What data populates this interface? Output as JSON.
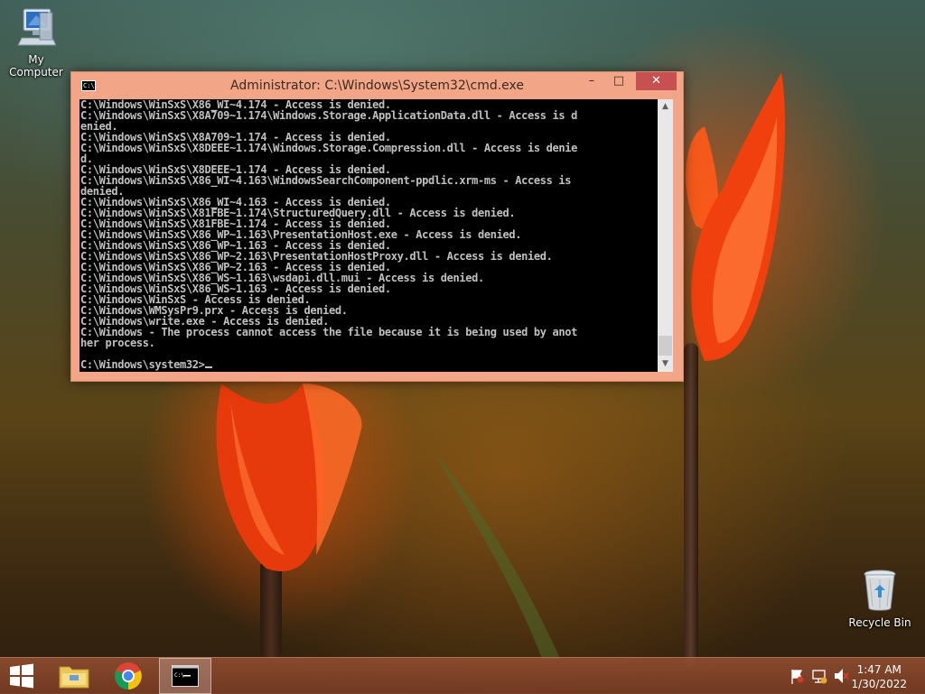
{
  "desktop": {
    "icons": [
      {
        "label": "My Computer"
      },
      {
        "label": "Recycle Bin"
      }
    ]
  },
  "cmd_window": {
    "title": "Administrator: C:\\Windows\\System32\\cmd.exe",
    "icon_text": "C:\\",
    "minimize_glyph": "–",
    "maximize_glyph": "□",
    "close_glyph": "✕",
    "console_lines": [
      "C:\\Windows\\WinSxS\\X86_WI~4.174 - Access is denied.",
      "C:\\Windows\\WinSxS\\X8A709~1.174\\Windows.Storage.ApplicationData.dll - Access is d",
      "enied.",
      "C:\\Windows\\WinSxS\\X8A709~1.174 - Access is denied.",
      "C:\\Windows\\WinSxS\\X8DEEE~1.174\\Windows.Storage.Compression.dll - Access is denie",
      "d.",
      "C:\\Windows\\WinSxS\\X8DEEE~1.174 - Access is denied.",
      "C:\\Windows\\WinSxS\\X86_WI~4.163\\WindowsSearchComponent-ppdlic.xrm-ms - Access is",
      "denied.",
      "C:\\Windows\\WinSxS\\X86_WI~4.163 - Access is denied.",
      "C:\\Windows\\WinSxS\\X81FBE~1.174\\StructuredQuery.dll - Access is denied.",
      "C:\\Windows\\WinSxS\\X81FBE~1.174 - Access is denied.",
      "C:\\Windows\\WinSxS\\X86_WP~1.163\\PresentationHost.exe - Access is denied.",
      "C:\\Windows\\WinSxS\\X86_WP~1.163 - Access is denied.",
      "C:\\Windows\\WinSxS\\X86_WP~2.163\\PresentationHostProxy.dll - Access is denied.",
      "C:\\Windows\\WinSxS\\X86_WP~2.163 - Access is denied.",
      "C:\\Windows\\WinSxS\\X86_WS~1.163\\wsdapi.dll.mui - Access is denied.",
      "C:\\Windows\\WinSxS\\X86_WS~1.163 - Access is denied.",
      "C:\\Windows\\WinSxS - Access is denied.",
      "C:\\Windows\\WMSysPr9.prx - Access is denied.",
      "C:\\Windows\\write.exe - Access is denied.",
      "C:\\Windows - The process cannot access the file because it is being used by anot",
      "her process."
    ],
    "prompt": "C:\\Windows\\system32>"
  },
  "taskbar": {
    "items": [
      {
        "name": "File Explorer",
        "icon": "folder-icon"
      },
      {
        "name": "Google Chrome",
        "icon": "chrome-icon"
      },
      {
        "name": "Command Prompt",
        "icon": "cmd-icon",
        "active": true
      }
    ],
    "clock": {
      "time": "1:47 AM",
      "date": "1/30/2022"
    }
  },
  "colors": {
    "title_bar": "#f2a687",
    "close_button": "#c75050",
    "console_bg": "#000000",
    "console_text": "#c0c0c0"
  }
}
